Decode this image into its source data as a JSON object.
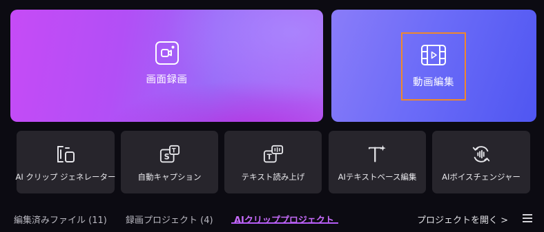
{
  "cards": {
    "record": {
      "label": "画面録画",
      "icon": "screen-record-icon"
    },
    "edit": {
      "label": "動画編集",
      "icon": "film-play-icon",
      "focus_color": "#f0882a"
    }
  },
  "tools": [
    {
      "label": "AI クリップ ジェネレーター",
      "icon": "ai-clip-icon"
    },
    {
      "label": "自動キャプション",
      "icon": "caption-icon"
    },
    {
      "label": "テキスト読み上げ",
      "icon": "text-to-speech-icon"
    },
    {
      "label": "AIテキストベース編集",
      "icon": "text-edit-icon"
    },
    {
      "label": "AIボイスチェンジャー",
      "icon": "voice-changer-icon"
    }
  ],
  "tabs": [
    {
      "label": "編集済みファイル (11)",
      "active": false
    },
    {
      "label": "録画プロジェクト (4)",
      "active": false
    },
    {
      "label": "AIクリッププロジェクト",
      "active": true
    }
  ],
  "open_project": "プロジェクトを開く >",
  "colors": {
    "accent": "#c66bf9",
    "card_bg": "#27252c",
    "background": "#0c0b12"
  }
}
